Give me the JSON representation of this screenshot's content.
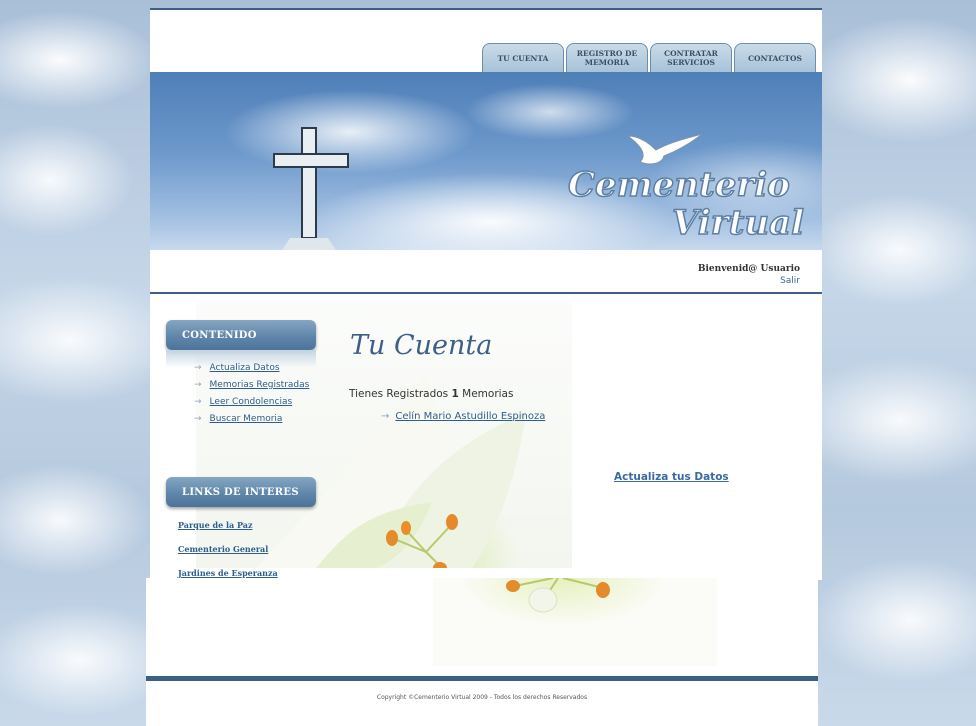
{
  "nav": {
    "tabs": [
      "TU CUENTA",
      "REGISTRO DE MEMORIA",
      "CONTRATAR SERVICIOS",
      "CONTACTOS"
    ]
  },
  "banner": {
    "logo_line1": "Cementerio",
    "logo_line2": "Virtual"
  },
  "user": {
    "greeting": "Bienvenid@ Usuario",
    "logout": "Salir"
  },
  "sidebar": {
    "content_title": "CONTENIDO",
    "content_items": [
      "Actualiza Datos",
      "Memorias Registradas",
      "Leer Condolencias",
      "Buscar Memoria"
    ],
    "links_title": "LINKS DE INTERES",
    "links": [
      "Parque de la Paz",
      "Cementerio General",
      "Jardines de Esperanza"
    ]
  },
  "main": {
    "title": "Tu Cuenta",
    "count_prefix": "Tienes Registrados",
    "count_value": "1",
    "count_suffix": "Memorias",
    "memories": [
      "Celín Mario Astudillo Espinoza"
    ],
    "update_link": "Actualiza tus Datos"
  },
  "footer": {
    "copyright": "Copyright ©Cementerio Virtual 2009 - Todos los derechos Reservados"
  },
  "colors": {
    "accent": "#3c5f86",
    "link": "#2f5d8c"
  }
}
